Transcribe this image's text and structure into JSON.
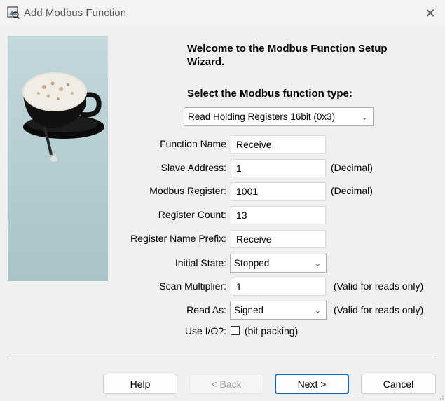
{
  "window": {
    "title": "Add Modbus Function",
    "close_glyph": "✕"
  },
  "wizard": {
    "welcome": "Welcome to the Modbus Function Setup Wizard.",
    "select_prompt": "Select the Modbus function type:",
    "function_type": "Read Holding Registers 16bit (0x3)"
  },
  "form": {
    "function_name": {
      "label": "Function Name",
      "value": "Receive"
    },
    "slave_address": {
      "label": "Slave Address:",
      "value": "1",
      "note": "(Decimal)"
    },
    "modbus_register": {
      "label": "Modbus Register:",
      "value": "1001",
      "note": "(Decimal)"
    },
    "register_count": {
      "label": "Register Count:",
      "value": "13"
    },
    "register_name_prefix": {
      "label": "Register Name Prefix:",
      "value": "Receive"
    },
    "initial_state": {
      "label": "Initial State:",
      "value": "Stopped"
    },
    "scan_multiplier": {
      "label": "Scan Multiplier:",
      "value": "1",
      "note": "(Valid for reads only)"
    },
    "read_as": {
      "label": "Read As:",
      "value": "Signed",
      "note": "(Valid for reads only)"
    },
    "use_io": {
      "label": "Use I/O?:",
      "checked": false,
      "suffix": "(bit packing)"
    }
  },
  "buttons": {
    "help": "Help",
    "back": "< Back",
    "next": "Next >",
    "cancel": "Cancel"
  }
}
